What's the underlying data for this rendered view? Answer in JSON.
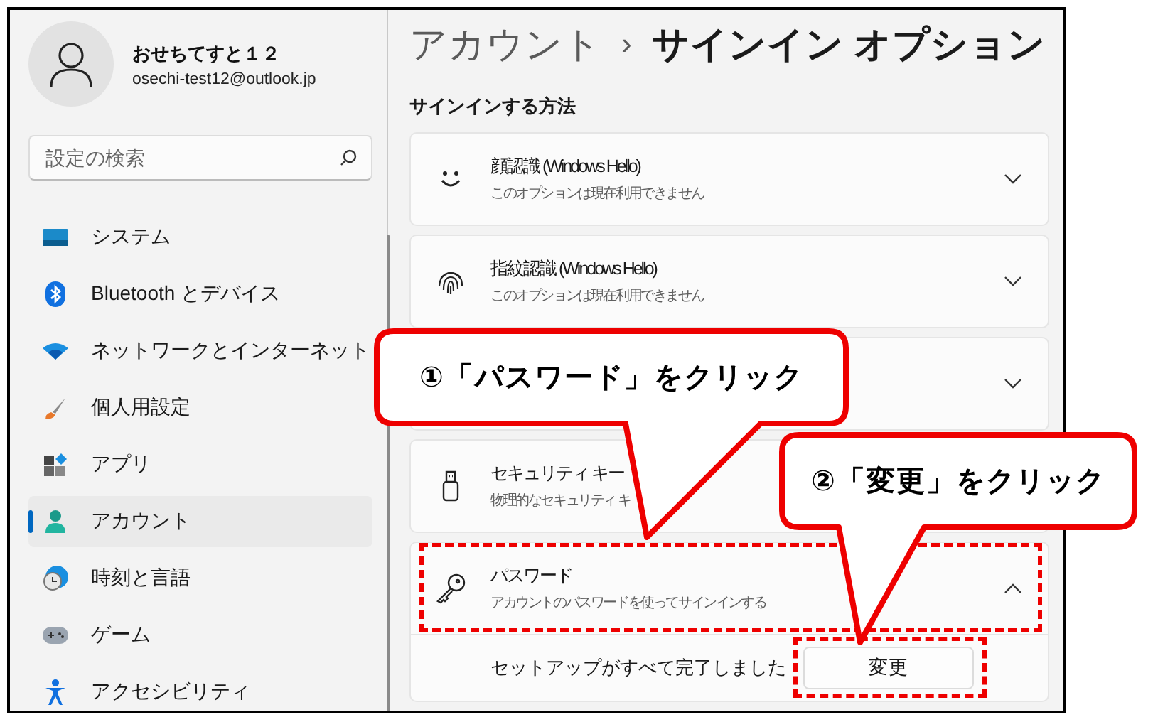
{
  "profile": {
    "name": "おせちてすと１２",
    "email": "osechi-test12@outlook.jp"
  },
  "search": {
    "placeholder": "設定の検索"
  },
  "nav": [
    {
      "label": "システム",
      "selected": false
    },
    {
      "label": "Bluetooth とデバイス",
      "selected": false
    },
    {
      "label": "ネットワークとインターネット",
      "selected": false
    },
    {
      "label": "個人用設定",
      "selected": false
    },
    {
      "label": "アプリ",
      "selected": false
    },
    {
      "label": "アカウント",
      "selected": true
    },
    {
      "label": "時刻と言語",
      "selected": false
    },
    {
      "label": "ゲーム",
      "selected": false
    },
    {
      "label": "アクセシビリティ",
      "selected": false
    }
  ],
  "breadcrumb": {
    "parent": "アカウント",
    "separator": "›",
    "current": "サインイン オプション"
  },
  "section_title": "サインインする方法",
  "cards": [
    {
      "title": "顔認識 (Windows Hello)",
      "subtitle": "このオプションは現在利用できません",
      "expanded": false
    },
    {
      "title": "指紋認識 (Windows Hello)",
      "subtitle": "このオプションは現在利用できません",
      "expanded": false
    },
    {
      "expanded": false
    },
    {
      "title": "セキュリティ キー",
      "subtitle": "物理的なセキュリティ キ"
    },
    {
      "title": "パスワード",
      "subtitle": "アカウントのパスワードを使ってサインインする",
      "expanded": true,
      "highlighted": true,
      "detail": {
        "text": "セットアップがすべて完了しました",
        "button": {
          "label": "変更",
          "highlighted": true
        }
      }
    }
  ],
  "callouts": [
    {
      "text": "①「パスワード」をクリック"
    },
    {
      "text": "②「変更」をクリック"
    }
  ]
}
